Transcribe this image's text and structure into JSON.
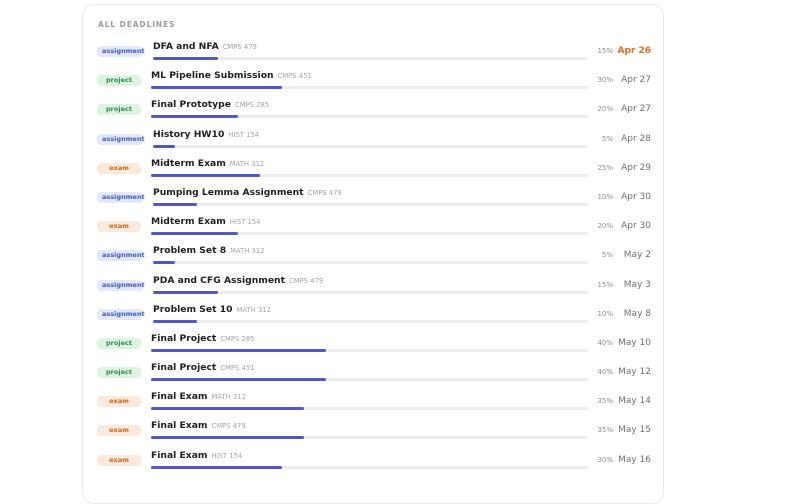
{
  "section_title": "ALL DEADLINES",
  "colors": {
    "urgent": "#e36a1a",
    "progress": "#5457c9"
  },
  "deadlines": [
    {
      "type": "assignment",
      "name": "DFA and NFA",
      "course": "CMPS 479",
      "percent": "15%",
      "date": "Apr 26",
      "urgent": true,
      "progress": 0.15
    },
    {
      "type": "project",
      "name": "ML Pipeline Submission",
      "course": "CMPS 451",
      "percent": "30%",
      "date": "Apr 27",
      "urgent": false,
      "progress": 0.3
    },
    {
      "type": "project",
      "name": "Final Prototype",
      "course": "CMPS 285",
      "percent": "20%",
      "date": "Apr 27",
      "urgent": false,
      "progress": 0.2
    },
    {
      "type": "assignment",
      "name": "History HW10",
      "course": "HIST 154",
      "percent": "5%",
      "date": "Apr 28",
      "urgent": false,
      "progress": 0.05
    },
    {
      "type": "exam",
      "name": "Midterm Exam",
      "course": "MATH 312",
      "percent": "25%",
      "date": "Apr 29",
      "urgent": false,
      "progress": 0.25
    },
    {
      "type": "assignment",
      "name": "Pumping Lemma Assignment",
      "course": "CMPS 479",
      "percent": "10%",
      "date": "Apr 30",
      "urgent": false,
      "progress": 0.1
    },
    {
      "type": "exam",
      "name": "Midterm Exam",
      "course": "HIST 154",
      "percent": "20%",
      "date": "Apr 30",
      "urgent": false,
      "progress": 0.2
    },
    {
      "type": "assignment",
      "name": "Problem Set 8",
      "course": "MATH 312",
      "percent": "5%",
      "date": "May 2",
      "urgent": false,
      "progress": 0.05
    },
    {
      "type": "assignment",
      "name": "PDA and CFG Assignment",
      "course": "CMPS 479",
      "percent": "15%",
      "date": "May 3",
      "urgent": false,
      "progress": 0.15
    },
    {
      "type": "assignment",
      "name": "Problem Set 10",
      "course": "MATH 312",
      "percent": "10%",
      "date": "May 8",
      "urgent": false,
      "progress": 0.1
    },
    {
      "type": "project",
      "name": "Final Project",
      "course": "CMPS 285",
      "percent": "40%",
      "date": "May 10",
      "urgent": false,
      "progress": 0.4
    },
    {
      "type": "project",
      "name": "Final Project",
      "course": "CMPS 451",
      "percent": "40%",
      "date": "May 12",
      "urgent": false,
      "progress": 0.4
    },
    {
      "type": "exam",
      "name": "Final Exam",
      "course": "MATH 312",
      "percent": "35%",
      "date": "May 14",
      "urgent": false,
      "progress": 0.35
    },
    {
      "type": "exam",
      "name": "Final Exam",
      "course": "CMPS 479",
      "percent": "35%",
      "date": "May 15",
      "urgent": false,
      "progress": 0.35
    },
    {
      "type": "exam",
      "name": "Final Exam",
      "course": "HIST 154",
      "percent": "30%",
      "date": "May 16",
      "urgent": false,
      "progress": 0.3
    }
  ]
}
